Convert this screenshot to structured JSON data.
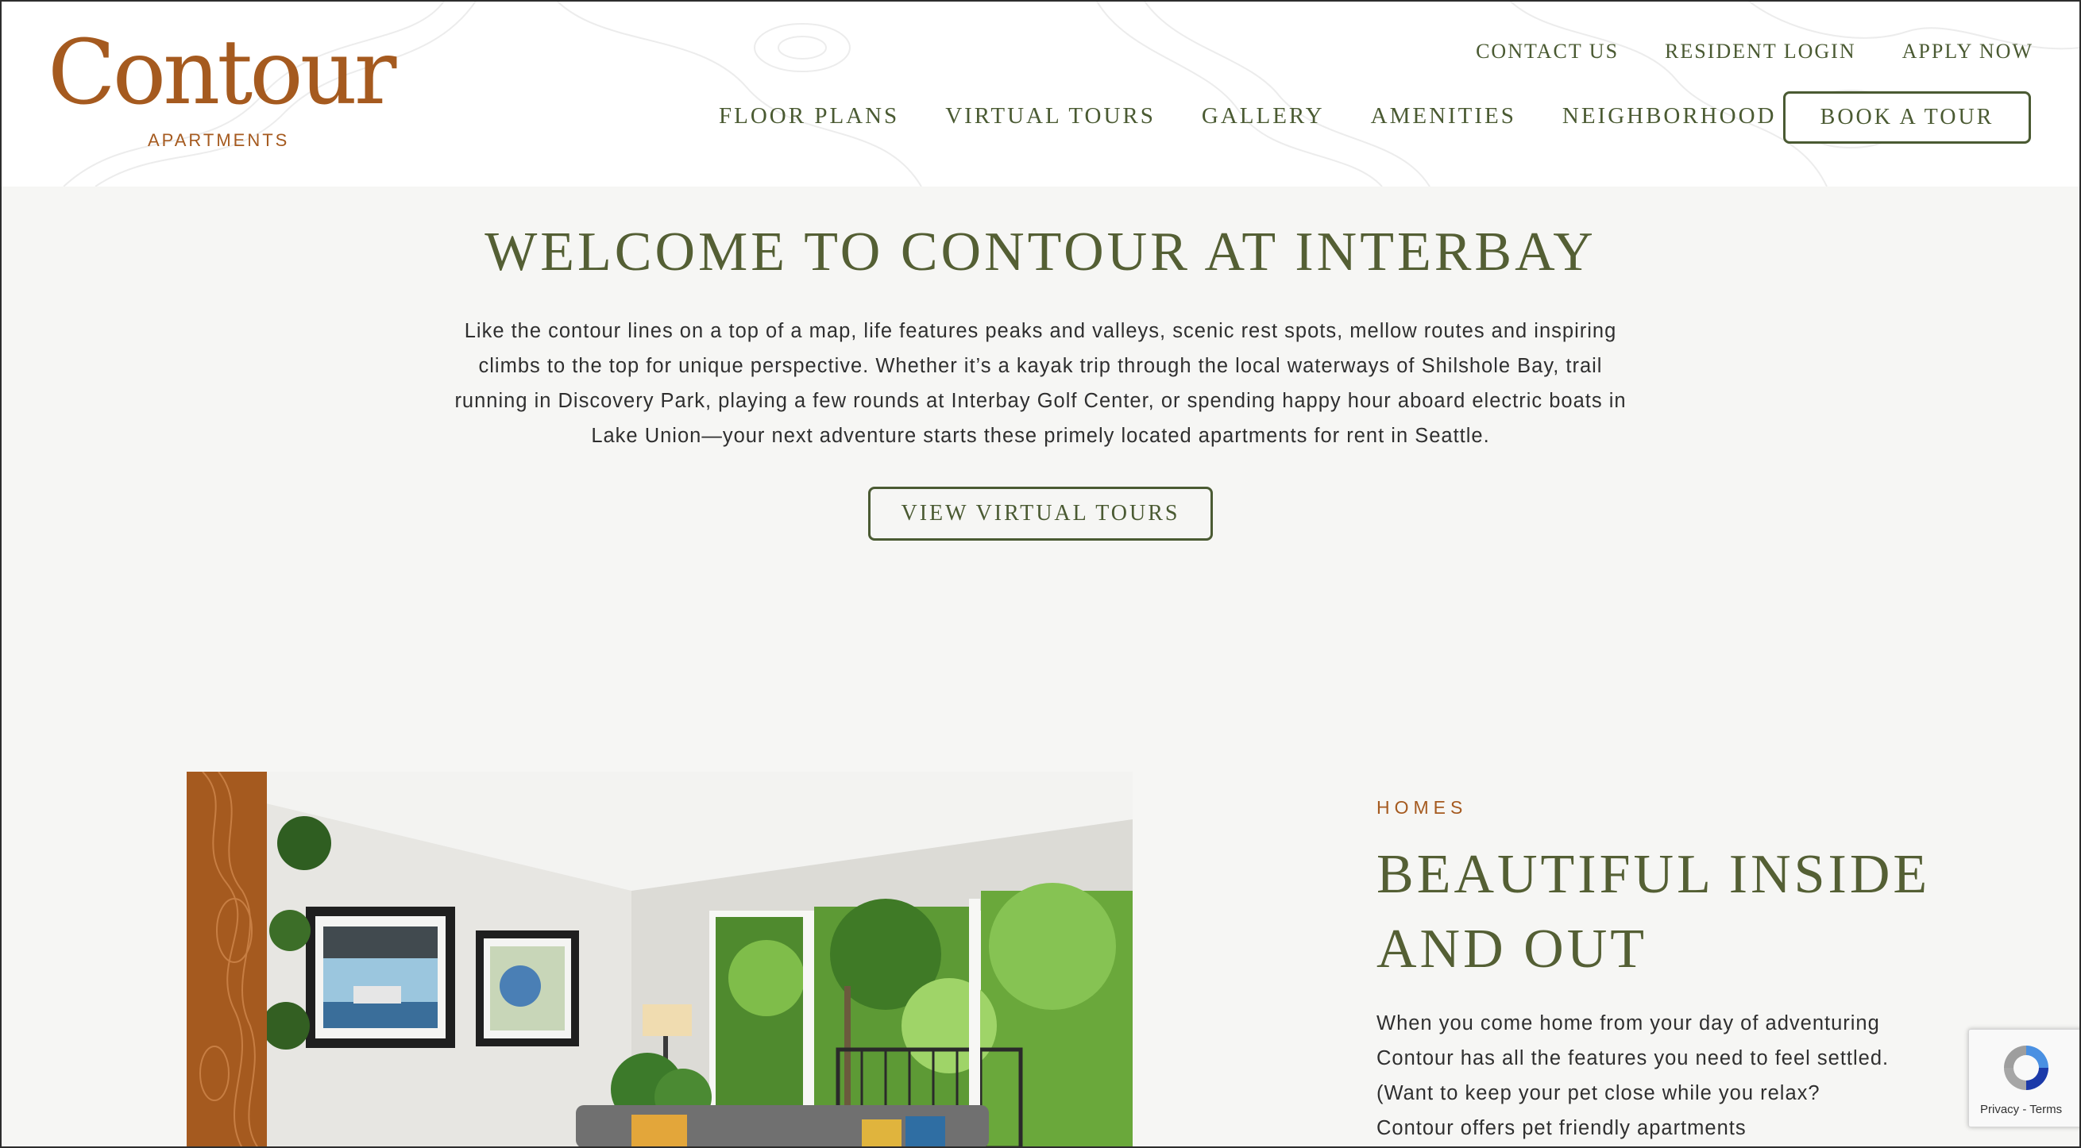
{
  "header": {
    "logo": {
      "name": "Contour",
      "subtitle": "APARTMENTS"
    },
    "util_nav": [
      "CONTACT US",
      "RESIDENT LOGIN",
      "APPLY NOW"
    ],
    "main_nav": [
      "FLOOR PLANS",
      "VIRTUAL TOURS",
      "GALLERY",
      "AMENITIES",
      "NEIGHBORHOOD"
    ],
    "cta_label": "BOOK A TOUR"
  },
  "welcome": {
    "title": "WELCOME TO CONTOUR AT INTERBAY",
    "body": "Like the contour lines on a top of a map, life features peaks and valleys, scenic rest spots, mellow routes and inspiring climbs to the top for unique perspective. Whether it’s a kayak trip through the local waterways of Shilshole Bay, trail running in Discovery Park, playing a few rounds at Interbay Golf Center, or spending happy hour aboard electric boats in Lake Union—your next adventure starts these primely located apartments for rent in Seattle.",
    "button_label": "VIEW VIRTUAL TOURS"
  },
  "homes": {
    "eyebrow": "HOMES",
    "title": "BEAUTIFUL INSIDE AND OUT",
    "body": "When you come home from your day of adventuring Contour has all the features you need to feel settled. (Want to keep your pet close while you relax? Contour offers pet friendly apartments"
  },
  "recaptcha": {
    "links": "Privacy - Terms"
  },
  "colors": {
    "brand_orange": "#a55a1f",
    "olive": "#545f34",
    "page_bg": "#f6f6f4"
  }
}
